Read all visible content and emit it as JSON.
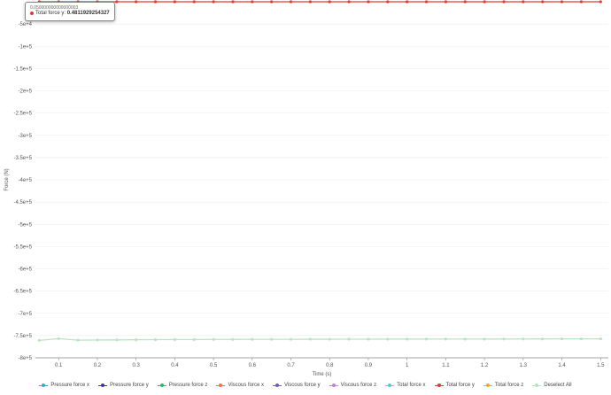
{
  "chart_data": {
    "type": "line",
    "xlabel": "Time (s)",
    "ylabel": "Force (N)",
    "xlim": [
      0.04,
      1.52
    ],
    "ylim": [
      -800000,
      0
    ],
    "x_ticks": [
      0.1,
      0.2,
      0.3,
      0.4,
      0.5,
      0.6,
      0.7,
      0.8,
      0.9,
      1,
      1.1,
      1.2,
      1.3,
      1.4,
      1.5
    ],
    "y_ticks": [
      {
        "value": -50000,
        "label": "-5e+4"
      },
      {
        "value": -100000,
        "label": "-1e+5"
      },
      {
        "value": -150000,
        "label": "-1.5e+5"
      },
      {
        "value": -200000,
        "label": "-2e+5"
      },
      {
        "value": -250000,
        "label": "-2.5e+5"
      },
      {
        "value": -300000,
        "label": "-3e+5"
      },
      {
        "value": -350000,
        "label": "-3.5e+5"
      },
      {
        "value": -400000,
        "label": "-4e+5"
      },
      {
        "value": -450000,
        "label": "-4.5e+5"
      },
      {
        "value": -500000,
        "label": "-5e+5"
      },
      {
        "value": -550000,
        "label": "-5.5e+5"
      },
      {
        "value": -600000,
        "label": "-6e+5"
      },
      {
        "value": -650000,
        "label": "-6.5e+5"
      },
      {
        "value": -700000,
        "label": "-7e+5"
      },
      {
        "value": -750000,
        "label": "-7.5e+5"
      },
      {
        "value": -800000,
        "label": "-8e+5"
      }
    ],
    "grid": true,
    "legend_position": "bottom",
    "x": [
      0.05,
      0.1,
      0.15,
      0.2,
      0.25,
      0.3,
      0.35,
      0.4,
      0.45,
      0.5,
      0.55,
      0.6,
      0.65,
      0.7,
      0.75,
      0.8,
      0.85,
      0.9,
      0.95,
      1.0,
      1.05,
      1.1,
      1.15,
      1.2,
      1.25,
      1.3,
      1.35,
      1.4,
      1.45,
      1.5
    ],
    "series": [
      {
        "name": "Pressure force x",
        "color": "#2ab0c8",
        "visible": false,
        "values": []
      },
      {
        "name": "Pressure force y",
        "color": "#3a3a9e",
        "visible": false,
        "values": []
      },
      {
        "name": "Pressure force z",
        "color": "#1fbf72",
        "visible": false,
        "values": []
      },
      {
        "name": "Viscous force x",
        "color": "#ff7043",
        "visible": false,
        "values": []
      },
      {
        "name": "Viscous force y",
        "color": "#6a5fb8",
        "visible": false,
        "values": []
      },
      {
        "name": "Viscous force z",
        "color": "#c77fe0",
        "visible": false,
        "values": []
      },
      {
        "name": "Total force x",
        "color": "#4fd1c5",
        "visible": false,
        "values": []
      },
      {
        "name": "Total force y",
        "color": "#e53935",
        "visible": true,
        "values": [
          0.48,
          0.48,
          0.48,
          0.48,
          0.48,
          0.48,
          0.48,
          0.48,
          0.48,
          0.48,
          0.48,
          0.48,
          0.48,
          0.48,
          0.48,
          0.48,
          0.48,
          0.48,
          0.48,
          0.48,
          0.48,
          0.48,
          0.48,
          0.48,
          0.48,
          0.48,
          0.48,
          0.48,
          0.48,
          0.48
        ]
      },
      {
        "name": "Total force z",
        "color": "#f5a623",
        "visible": false,
        "values": []
      },
      {
        "name": "Deselect All",
        "color": "#b9e4c2",
        "visible": true,
        "values": [
          -761000,
          -757000,
          -760500,
          -760000,
          -759800,
          -759500,
          -759200,
          -759000,
          -758900,
          -758700,
          -758600,
          -758500,
          -758500,
          -758400,
          -758300,
          -758300,
          -758200,
          -758200,
          -758100,
          -758100,
          -758000,
          -758000,
          -757900,
          -757900,
          -757800,
          -757700,
          -757600,
          -757500,
          -757400,
          -757400
        ]
      }
    ]
  },
  "tooltip": {
    "x_value": "0.050000000000000003",
    "series_name": "Total force y",
    "separator": ": ",
    "value": "0.4811929254327",
    "color": "#e53935"
  }
}
